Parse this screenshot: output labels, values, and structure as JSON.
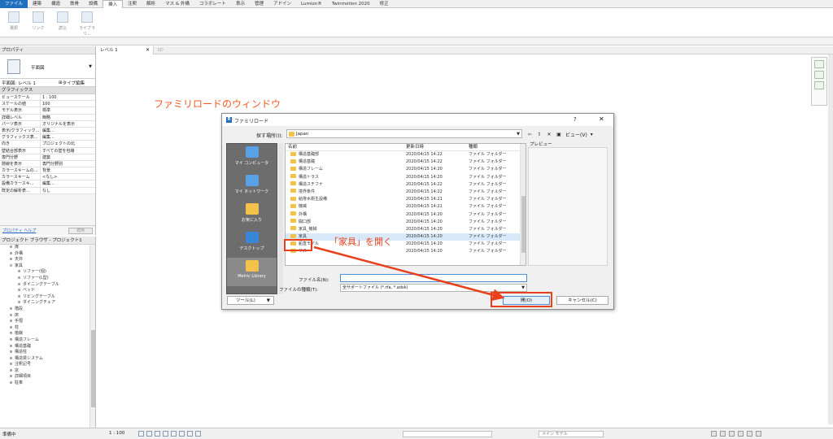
{
  "menu": {
    "tabs": [
      "ファイル",
      "建築",
      "構造",
      "鉄骨",
      "設備",
      "挿入",
      "注釈",
      "解析",
      "マス & 外構",
      "コラボレート",
      "表示",
      "管理",
      "アドイン",
      "Lumion®",
      "Twinmotion 2020",
      "修正"
    ]
  },
  "ribbon": {
    "buttons": [
      "選択",
      "リンク",
      "読込",
      "ライブラリ..."
    ]
  },
  "properties": {
    "title": "プロパティ",
    "type_name": "平面図",
    "level_selector": "平面図: レベル 1",
    "edit_type": "タイプ編集",
    "group": "グラフィックス",
    "rows": [
      {
        "k": "ビュースケール",
        "v": "1 : 100"
      },
      {
        "k": "スケールの値",
        "v": "100"
      },
      {
        "k": "モデル表示",
        "v": "標準"
      },
      {
        "k": "詳細レベル",
        "v": "簡略"
      },
      {
        "k": "パーツ表示",
        "v": "オリジナルを表示"
      },
      {
        "k": "表示/グラフィック...",
        "v": "編集..."
      },
      {
        "k": "グラフィックス表...",
        "v": "編集..."
      },
      {
        "k": "向き",
        "v": "プロジェクトの北"
      },
      {
        "k": "壁結合部表示",
        "v": "すべての壁を包絡"
      },
      {
        "k": "専門分野",
        "v": "建築"
      },
      {
        "k": "隠線を表示",
        "v": "専門分野別"
      },
      {
        "k": "カラースキームの...",
        "v": "背景"
      },
      {
        "k": "カラースキーム",
        "v": "<なし>"
      },
      {
        "k": "設備カラースキ...",
        "v": "編集..."
      },
      {
        "k": "既定の解析表...",
        "v": "なし"
      }
    ],
    "help_link": "プロパティ ヘルプ",
    "apply": "適用"
  },
  "browser": {
    "title": "プロジェクト ブラウザ - プロジェクト1",
    "items": [
      {
        "exp": "⊞",
        "label": "扉",
        "indent": 1
      },
      {
        "exp": "⊞",
        "label": "外構",
        "indent": 1
      },
      {
        "exp": "⊞",
        "label": "天井",
        "indent": 1
      },
      {
        "exp": "⊟",
        "label": "家具",
        "indent": 1
      },
      {
        "exp": "⊞",
        "label": "ソファー(個)",
        "indent": 2
      },
      {
        "exp": "⊞",
        "label": "ソファー(L型)",
        "indent": 2
      },
      {
        "exp": "⊞",
        "label": "ダイニングテーブル",
        "indent": 2
      },
      {
        "exp": "⊞",
        "label": "ベッド",
        "indent": 2
      },
      {
        "exp": "⊞",
        "label": "リビングテーブル",
        "indent": 2
      },
      {
        "exp": "⊞",
        "label": "ダイニングチェア",
        "indent": 2
      },
      {
        "exp": "⊞",
        "label": "階段",
        "indent": 1
      },
      {
        "exp": "⊞",
        "label": "床",
        "indent": 1
      },
      {
        "exp": "⊞",
        "label": "手摺",
        "indent": 1
      },
      {
        "exp": "⊞",
        "label": "柱",
        "indent": 1
      },
      {
        "exp": "⊞",
        "label": "植栽",
        "indent": 1
      },
      {
        "exp": "⊞",
        "label": "構造フレーム",
        "indent": 1
      },
      {
        "exp": "⊞",
        "label": "構造基礎",
        "indent": 1
      },
      {
        "exp": "⊞",
        "label": "構造柱",
        "indent": 1
      },
      {
        "exp": "⊞",
        "label": "構造梁システム",
        "indent": 1
      },
      {
        "exp": "⊞",
        "label": "注釈記号",
        "indent": 1
      },
      {
        "exp": "⊞",
        "label": "窓",
        "indent": 1
      },
      {
        "exp": "⊞",
        "label": "詳細項目",
        "indent": 1
      },
      {
        "exp": "⊞",
        "label": "駐車",
        "indent": 1
      }
    ]
  },
  "view": {
    "tab_label": "レベル 1",
    "tab2_label": "3D",
    "annotation_title": "ファミリロードのウィンドウ"
  },
  "dialog": {
    "title": "ファミリロード",
    "help": "?",
    "close": "✕",
    "look_in_label": "探す場所(I):",
    "look_in_value": "Japan",
    "view_label": "ビュー(V)",
    "preview_label": "プレビュー",
    "columns": {
      "name": "名前",
      "date": "更新日時",
      "type": "種類"
    },
    "files": [
      {
        "name": "構造基礎部",
        "date": "2020/04/15 14:22",
        "type": "ファイル フォルダー"
      },
      {
        "name": "構造基礎",
        "date": "2020/04/15 14:22",
        "type": "ファイル フォルダー"
      },
      {
        "name": "構造フレーム",
        "date": "2020/04/15 14:20",
        "type": "ファイル フォルダー"
      },
      {
        "name": "構造トラス",
        "date": "2020/04/15 14:20",
        "type": "ファイル フォルダー"
      },
      {
        "name": "構造スチフナ",
        "date": "2020/04/15 14:22",
        "type": "ファイル フォルダー"
      },
      {
        "name": "境界条件",
        "date": "2020/04/15 14:22",
        "type": "ファイル フォルダー"
      },
      {
        "name": "給排水衛生設備",
        "date": "2020/04/15 14:21",
        "type": "ファイル フォルダー"
      },
      {
        "name": "機械",
        "date": "2020/04/15 14:21",
        "type": "ファイル フォルダー"
      },
      {
        "name": "外構",
        "date": "2020/04/15 14:20",
        "type": "ファイル フォルダー"
      },
      {
        "name": "開口部",
        "date": "2020/04/15 14:20",
        "type": "ファイル フォルダー"
      },
      {
        "name": "家具_機械",
        "date": "2020/04/15 14:20",
        "type": "ファイル フォルダー"
      },
      {
        "name": "家具",
        "date": "2020/04/15 14:20",
        "type": "ファイル フォルダー",
        "selected": true
      },
      {
        "name": "鉛直モデル",
        "date": "2020/04/15 14:20",
        "type": "ファイル フォルダー"
      },
      {
        "name": "マス",
        "date": "2020/04/15 14:20",
        "type": "ファイル フォルダー"
      }
    ],
    "places": [
      "マイ コンピュータ",
      "マイ ネットワーク",
      "お気に入り",
      "デスクトップ",
      "Metric Library"
    ],
    "file_name_label": "ファイル名(N):",
    "file_name_value": "",
    "file_type_label": "ファイルの種類(T):",
    "file_type_value": "全サポートファイル (*.rfa, *.adsk)",
    "tools_label": "ツール(L)",
    "open_label": "開(O)",
    "cancel_label": "キャンセル(C)"
  },
  "annotations": {
    "step_text": "「家具」を開く",
    "highlight_color": "#e8401c"
  },
  "status": {
    "text": "準備中",
    "scale": "1 : 100",
    "model": "メイン モデル"
  },
  "icons": {
    "look_in_folder": "folder-icon",
    "file_folder": "folder-icon",
    "places": [
      "computer-icon",
      "network-icon",
      "favorites-icon",
      "desktop-icon",
      "library-icon"
    ]
  },
  "colors": {
    "accent": "#1f6fbf",
    "annotation": "#f15a24",
    "folder": "#f3c24a",
    "selection": "#d9e9f9"
  }
}
